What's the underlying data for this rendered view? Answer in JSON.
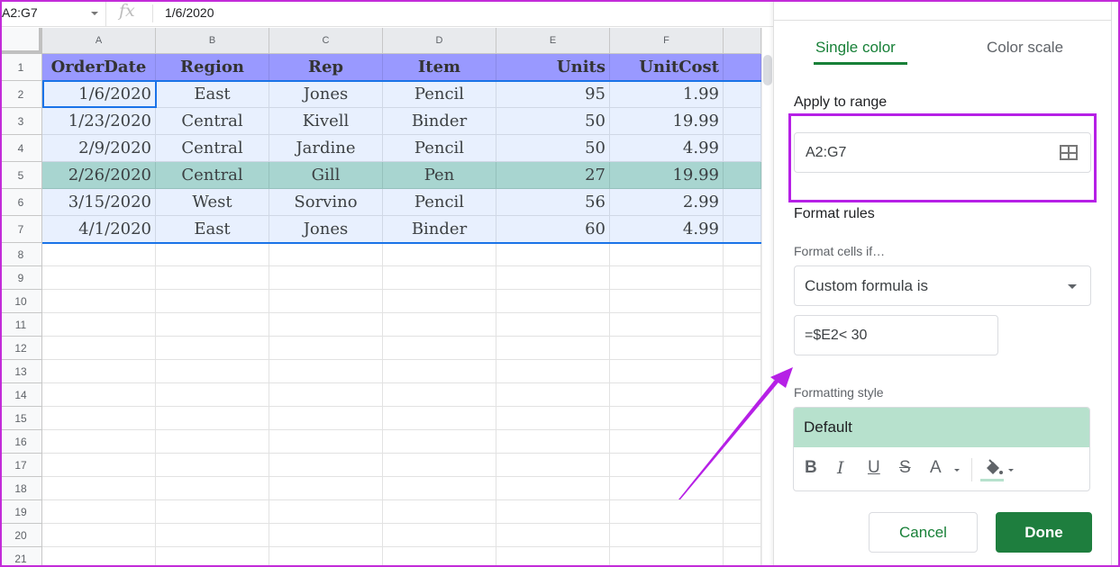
{
  "formula_bar": {
    "name_box": "A2:G7",
    "fx_label": "fx",
    "value": "1/6/2020"
  },
  "sheet": {
    "columns": [
      "A",
      "B",
      "C",
      "D",
      "E",
      "F",
      ""
    ],
    "rows": [
      "1",
      "2",
      "3",
      "4",
      "5",
      "6",
      "7",
      "8",
      "9",
      "10",
      "11",
      "12",
      "13",
      "14",
      "15",
      "16",
      "17",
      "18",
      "19",
      "20",
      "21"
    ],
    "header": [
      "OrderDate",
      "Region",
      "Rep",
      "Item",
      "Units",
      "UnitCost",
      ""
    ],
    "data": [
      [
        "1/6/2020",
        "East",
        "Jones",
        "Pencil",
        "95",
        "1.99",
        ""
      ],
      [
        "1/23/2020",
        "Central",
        "Kivell",
        "Binder",
        "50",
        "19.99",
        ""
      ],
      [
        "2/9/2020",
        "Central",
        "Jardine",
        "Pencil",
        "50",
        "4.99",
        ""
      ],
      [
        "2/26/2020",
        "Central",
        "Gill",
        "Pen",
        "27",
        "19.99",
        ""
      ],
      [
        "3/15/2020",
        "West",
        "Sorvino",
        "Pencil",
        "56",
        "2.99",
        ""
      ],
      [
        "4/1/2020",
        "East",
        "Jones",
        "Binder",
        "60",
        "4.99",
        ""
      ]
    ],
    "highlighted_row_index": 3,
    "colors": {
      "header_bg": "#9999ff",
      "selection_bg": "#e8f0fe",
      "highlight_bg": "#a8d5d0",
      "selection_border": "#1a73e8"
    }
  },
  "panel": {
    "tabs": [
      {
        "label": "Single color",
        "active": true
      },
      {
        "label": "Color scale",
        "active": false
      }
    ],
    "apply_to_range_label": "Apply to range",
    "range_value": "A2:G7",
    "format_rules_label": "Format rules",
    "format_cells_if_label": "Format cells if…",
    "condition_selected": "Custom formula is",
    "formula_value": "=$E2< 30",
    "formatting_style_label": "Formatting style",
    "style_preview_label": "Default",
    "style_tools": {
      "bold": "B",
      "italic": "I",
      "underline": "U",
      "strikethrough": "S",
      "text_color": "A"
    },
    "fill_color": "#b7e1cd",
    "cancel_label": "Cancel",
    "done_label": "Done",
    "accent_color": "#188038"
  },
  "annotations": {
    "highlight_color": "#b620e6"
  }
}
